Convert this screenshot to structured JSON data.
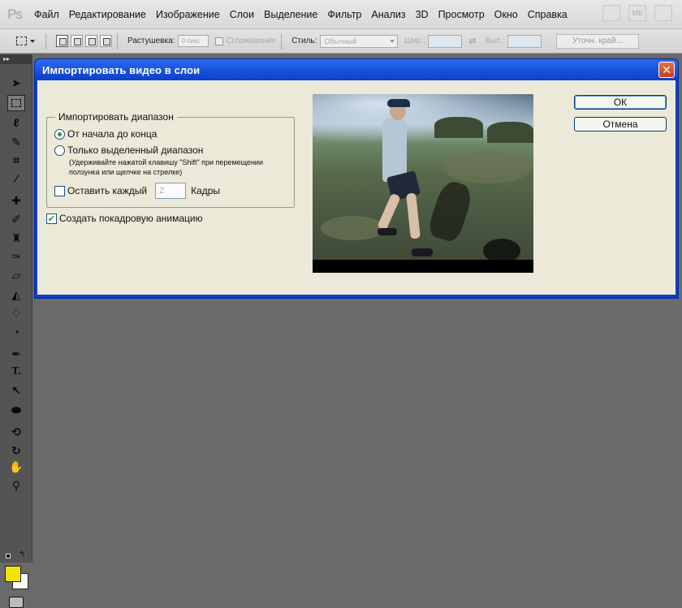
{
  "app": {
    "logo_text": "Ps"
  },
  "menu": {
    "items": [
      "Файл",
      "Редактирование",
      "Изображение",
      "Слои",
      "Выделение",
      "Фильтр",
      "Анализ",
      "3D",
      "Просмотр",
      "Окно",
      "Справка"
    ],
    "right_buttons": [
      "",
      "Mb",
      ""
    ]
  },
  "options_bar": {
    "feather_label": "Растушевка:",
    "feather_value": "0 пикс",
    "antialias_label": "Сглаживание",
    "style_label": "Стиль:",
    "style_value": "Обычный",
    "width_label": "Шир.:",
    "height_label": "Выс.:",
    "refine_edge_label": "Уточн. край..."
  },
  "toolbar": {
    "tools": [
      "move",
      "rectangular-marquee",
      "lasso",
      "quick-selection",
      "crop",
      "eyedropper",
      "spot-healing",
      "brush",
      "clone-stamp",
      "history-brush",
      "eraser",
      "paint-bucket",
      "blur",
      "dodge",
      "pen",
      "type",
      "path-selection",
      "ellipse",
      "3d-rotate",
      "3d-orbit",
      "hand",
      "zoom"
    ],
    "foreground_color": "#f2e30a",
    "background_color": "#fafafa"
  },
  "dialog": {
    "title": "Импортировать видео в слои",
    "range_group_label": "Импортировать диапазон",
    "option_all": "От начала до конца",
    "option_selected": "Только выделенный диапазон",
    "hint": "(Удерживайте нажатой клавишу \"Shift\" при перемещении ползунка или щелчке на стрелке)",
    "keep_every_label": "Оставить каждый",
    "keep_every_value": "2",
    "frames_label": "Кадры",
    "make_animation_label": "Создать покадровую анимацию",
    "make_animation_checked": true,
    "range_selected": "all",
    "ok_label": "ОК",
    "cancel_label": "Отмена"
  }
}
